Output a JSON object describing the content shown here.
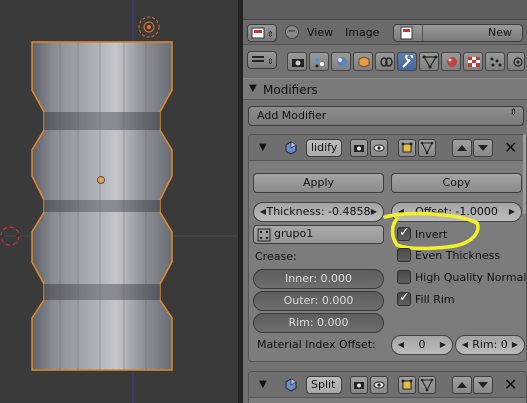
{
  "header": {
    "view_label": "View",
    "image_label": "Image",
    "new_label": "New"
  },
  "context_tabs": [
    "render-icon",
    "render-layers-icon",
    "scene-icon",
    "world-icon",
    "object-icon",
    "constraints-icon",
    "wrench-icon",
    "data-icon",
    "material-icon",
    "texture-icon",
    "particles-icon",
    "physics-icon"
  ],
  "modifiers_panel": {
    "title": "Modifiers",
    "add_modifier": "Add Modifier"
  },
  "solidify": {
    "name": "lidify",
    "apply_label": "Apply",
    "copy_label": "Copy",
    "thickness": "Thickness: -0.4858",
    "offset": "Offset: -1.0000",
    "vertex_group": "grupo1",
    "invert_label": "Invert",
    "invert_checked": true,
    "crease_label": "Crease:",
    "even_thickness_label": "Even Thickness",
    "even_thickness_checked": false,
    "high_quality_normals_label": "High Quality Normals",
    "high_quality_normals_checked": false,
    "inner": "Inner: 0.000",
    "outer": "Outer: 0.000",
    "rim": "Rim: 0.000",
    "fill_rim_label": "Fill Rim",
    "fill_rim_checked": true,
    "material_index_offset_label": "Material Index Offset:",
    "material_index_value": "0",
    "rim_index": "Rim: 0"
  },
  "split": {
    "name": "Split"
  },
  "colors": {
    "highlight": "#f2f22a",
    "selection_outline": "#e08a2c",
    "active_tab": "#5d7fae"
  }
}
